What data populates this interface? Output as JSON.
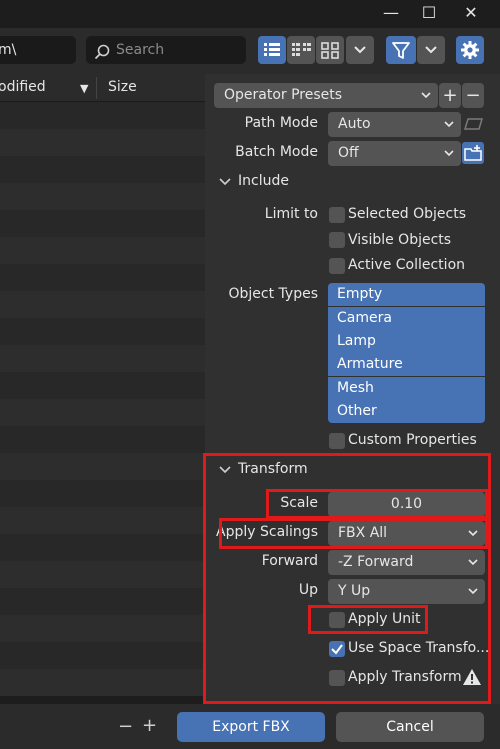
{
  "window": {
    "minimize_glyph": "—",
    "maximize_glyph": "☐",
    "close_glyph": "✕"
  },
  "toolbar": {
    "path_value": "m\\",
    "search_placeholder": "Search",
    "icons": [
      "display-vertical-list-icon",
      "display-horizontal-list-icon",
      "display-thumbnails-icon",
      "chevron-down-icon",
      "filter-icon",
      "chevron-down-icon",
      "settings-gear-icon"
    ]
  },
  "file_list": {
    "columns": [
      {
        "label": "odified",
        "sort_indicator": "▼"
      },
      {
        "label": "Size"
      }
    ]
  },
  "panel": {
    "operator_presets": "Operator Presets",
    "path_mode": {
      "label": "Path Mode",
      "value": "Auto"
    },
    "batch_mode": {
      "label": "Batch Mode",
      "value": "Off"
    },
    "include": {
      "title": "Include",
      "limit_to_label": "Limit to",
      "limit_to": [
        {
          "label": "Selected Objects",
          "checked": false
        },
        {
          "label": "Visible Objects",
          "checked": false
        },
        {
          "label": "Active Collection",
          "checked": false
        }
      ],
      "object_types_label": "Object Types",
      "object_types": [
        "Empty",
        "Camera",
        "Lamp",
        "Armature",
        "Mesh",
        "Other"
      ],
      "custom_properties": {
        "label": "Custom Properties",
        "checked": false
      }
    },
    "transform": {
      "title": "Transform",
      "scale": {
        "label": "Scale",
        "value": "0.10"
      },
      "apply_scalings": {
        "label": "Apply Scalings",
        "value": "FBX All"
      },
      "forward": {
        "label": "Forward",
        "value": "-Z Forward"
      },
      "up": {
        "label": "Up",
        "value": "Y Up"
      },
      "apply_unit": {
        "label": "Apply Unit",
        "checked": false
      },
      "use_space_transform": {
        "label": "Use Space Transfo...",
        "checked": true
      },
      "apply_transform": {
        "label": "Apply Transform",
        "checked": false
      }
    }
  },
  "bottom": {
    "minus": "−",
    "plus": "+",
    "export_label": "Export FBX",
    "cancel_label": "Cancel"
  },
  "colors": {
    "accent_blue": "#4772b3",
    "highlight_red": "#e01a1a",
    "panel_bg": "#303030",
    "field_bg": "#545454"
  }
}
